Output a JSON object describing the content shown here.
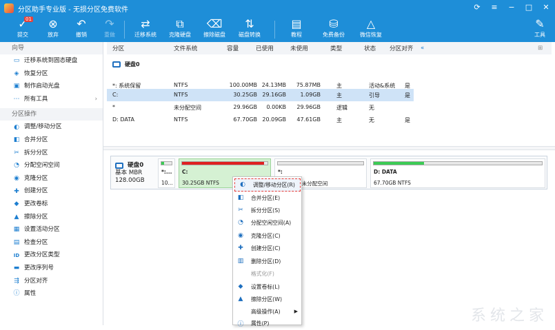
{
  "app": {
    "title": "分区助手专业版 - 无损分区免费软件"
  },
  "toolbar": {
    "commit": "提交",
    "commit_badge": "01",
    "discard": "放弃",
    "undo": "撤销",
    "redo": "重做",
    "migrate": "迁移系统",
    "clone_disk": "克隆硬盘",
    "wipe_disk": "擦除磁盘",
    "disk_convert": "磁盘转换",
    "tutorial": "教程",
    "free_backup": "免费备份",
    "wechat_restore": "微信恢复",
    "tools": "工具"
  },
  "sidebar": {
    "wizard_title": "向导",
    "wizard_items": [
      "迁移系统到固态硬盘",
      "恢复分区",
      "制作启动光盘",
      "所有工具"
    ],
    "ops_title": "分区操作",
    "ops_items": [
      "调整/移动分区",
      "合并分区",
      "拆分分区",
      "分配空闲空间",
      "克隆分区",
      "创建分区",
      "更改卷标",
      "擦除分区",
      "设置活动分区",
      "检查分区",
      "更改分区类型",
      "更改序列号",
      "分区对齐",
      "属性"
    ]
  },
  "table": {
    "headers": [
      "分区",
      "文件系统",
      "容量",
      "已使用",
      "未使用",
      "类型",
      "状态",
      "分区对齐"
    ],
    "disk_label": "硬盘0",
    "rows": [
      [
        "*: 系统保留",
        "NTFS",
        "100.00MB",
        "24.13MB",
        "75.87MB",
        "主",
        "活动&系统",
        "是"
      ],
      [
        "C:",
        "NTFS",
        "30.25GB",
        "29.16GB",
        "1.09GB",
        "主",
        "引导",
        "是"
      ],
      [
        "*",
        "未分配空间",
        "29.96GB",
        "0.00KB",
        "29.96GB",
        "逻辑",
        "无",
        ""
      ],
      [
        "D: DATA",
        "NTFS",
        "67.70GB",
        "20.09GB",
        "47.61GB",
        "主",
        "无",
        "是"
      ]
    ]
  },
  "diskmap": {
    "disk_name": "硬盘0",
    "disk_type": "基本 MBR",
    "disk_size": "128.00GB",
    "partitions": [
      {
        "label": "*:...",
        "sub": "10...",
        "used_fraction": 0.24
      },
      {
        "label": "C:",
        "sub": "30.25GB NTFS",
        "used_fraction": 0.96
      },
      {
        "label": "*:",
        "sub": "29.96GB 未分配空间",
        "used_fraction": 0.0
      },
      {
        "label": "D: DATA",
        "sub": "67.70GB NTFS",
        "used_fraction": 0.3
      }
    ]
  },
  "context_menu": {
    "items": [
      "调整/移动分区(R)",
      "合并分区(E)",
      "拆分分区(S)",
      "分配空闲空间(A)",
      "克隆分区(C)",
      "创建分区(C)",
      "删除分区(D)",
      "格式化(F)",
      "设置卷标(L)",
      "擦除分区(W)",
      "高级操作(A)",
      "属性(P)"
    ]
  },
  "colors": {
    "accent": "#1e8ed8",
    "used_red": "#e02020",
    "used_green": "#3ccc55"
  },
  "watermark": "系统之家"
}
